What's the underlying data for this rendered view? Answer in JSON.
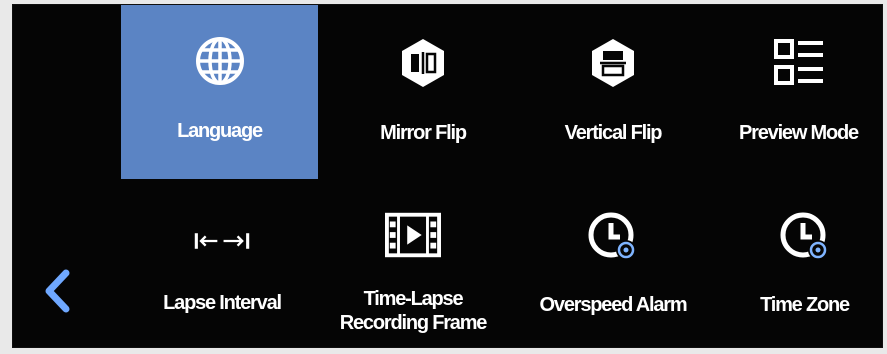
{
  "menu": {
    "row1": [
      {
        "label": "Language",
        "icon": "globe-icon",
        "selected": true
      },
      {
        "label": "Mirror Flip",
        "icon": "mirror-flip-icon",
        "selected": false
      },
      {
        "label": "Vertical Flip",
        "icon": "vertical-flip-icon",
        "selected": false
      },
      {
        "label": "Preview Mode",
        "icon": "list-view-icon",
        "selected": false
      }
    ],
    "row2": [
      {
        "label": "Lapse Interval",
        "icon": "interval-arrows-icon",
        "selected": false
      },
      {
        "label": "Time-Lapse Recording Frame",
        "icon": "film-frame-icon",
        "selected": false
      },
      {
        "label": "Overspeed Alarm",
        "icon": "clock-alarm-icon",
        "selected": false
      },
      {
        "label": "Time Zone",
        "icon": "clock-zone-icon",
        "selected": false
      }
    ]
  },
  "nav": {
    "back_icon": "chevron-left-icon"
  },
  "colors": {
    "background": "#050505",
    "selected_tile": "#5b84c4",
    "accent_icon": "#7fb4ff",
    "text": "#ffffff"
  }
}
